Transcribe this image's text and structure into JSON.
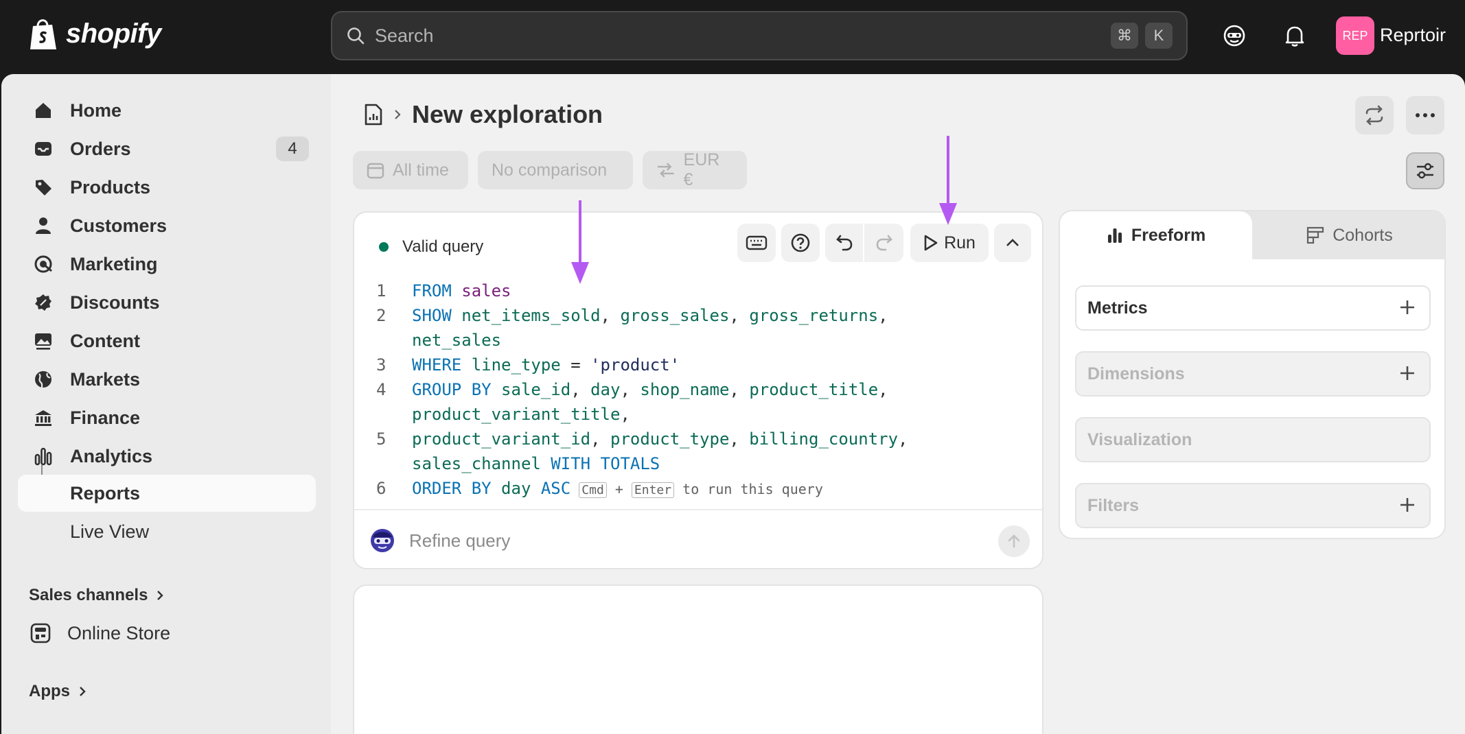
{
  "brand": {
    "name": "shopify"
  },
  "search": {
    "placeholder": "Search",
    "shortcut_keys": [
      "⌘",
      "K"
    ]
  },
  "user": {
    "avatar_text": "REP",
    "store_name": "Reprtoir"
  },
  "sidebar": {
    "items": [
      {
        "label": "Home",
        "icon": "home-icon"
      },
      {
        "label": "Orders",
        "icon": "inbox-icon",
        "badge": "4"
      },
      {
        "label": "Products",
        "icon": "tag-icon"
      },
      {
        "label": "Customers",
        "icon": "person-icon"
      },
      {
        "label": "Marketing",
        "icon": "target-icon"
      },
      {
        "label": "Discounts",
        "icon": "discount-icon"
      },
      {
        "label": "Content",
        "icon": "image-icon"
      },
      {
        "label": "Markets",
        "icon": "globe-icon"
      },
      {
        "label": "Finance",
        "icon": "bank-icon"
      },
      {
        "label": "Analytics",
        "icon": "bar-chart-icon"
      }
    ],
    "sub_items": [
      {
        "label": "Reports",
        "active": true
      },
      {
        "label": "Live View",
        "active": false
      }
    ],
    "sales_channels_title": "Sales channels",
    "online_store_label": "Online Store",
    "apps_title": "Apps"
  },
  "header": {
    "title": "New exploration"
  },
  "filters": {
    "date": "All time",
    "comparison": "No comparison",
    "currency": "EUR €"
  },
  "query": {
    "status": "Valid query",
    "run_label": "Run",
    "refine_placeholder": "Refine query",
    "hint": {
      "prefix": "Cmd",
      "plus": "+",
      "key": "Enter",
      "suffix": "to run this query"
    },
    "lines": [
      {
        "num": "1",
        "tokens": [
          [
            "kw",
            "FROM"
          ],
          [
            "sp",
            " "
          ],
          [
            "tbl",
            "sales"
          ]
        ]
      },
      {
        "num": "2",
        "tokens": [
          [
            "kw",
            "SHOW"
          ],
          [
            "sp",
            " "
          ],
          [
            "fld",
            "net_items_sold"
          ],
          [
            "sp",
            ", "
          ],
          [
            "fld",
            "gross_sales"
          ],
          [
            "sp",
            ", "
          ],
          [
            "fld",
            "gross_returns"
          ],
          [
            "sp",
            ",\n"
          ],
          [
            "fld",
            "net_sales"
          ]
        ]
      },
      {
        "num": "3",
        "tokens": [
          [
            "kw",
            "WHERE"
          ],
          [
            "sp",
            " "
          ],
          [
            "fld",
            "line_type"
          ],
          [
            "sp",
            " = "
          ],
          [
            "str",
            "'product'"
          ]
        ]
      },
      {
        "num": "4",
        "tokens": [
          [
            "kw",
            "GROUP BY"
          ],
          [
            "sp",
            " "
          ],
          [
            "fld",
            "sale_id"
          ],
          [
            "sp",
            ", "
          ],
          [
            "fld",
            "day"
          ],
          [
            "sp",
            ", "
          ],
          [
            "fld",
            "shop_name"
          ],
          [
            "sp",
            ", "
          ],
          [
            "fld",
            "product_title"
          ],
          [
            "sp",
            ",\n"
          ],
          [
            "fld",
            "product_variant_title"
          ],
          [
            "sp",
            ","
          ]
        ]
      },
      {
        "num": "5",
        "tokens": [
          [
            "fld",
            "product_variant_id"
          ],
          [
            "sp",
            ", "
          ],
          [
            "fld",
            "product_type"
          ],
          [
            "sp",
            ", "
          ],
          [
            "fld",
            "billing_country"
          ],
          [
            "sp",
            ",\n"
          ],
          [
            "fld",
            "sales_channel"
          ],
          [
            "sp",
            " "
          ],
          [
            "kw",
            "WITH TOTALS"
          ]
        ]
      },
      {
        "num": "6",
        "tokens": [
          [
            "kw",
            "ORDER BY"
          ],
          [
            "sp",
            " "
          ],
          [
            "fld",
            "day"
          ],
          [
            "sp",
            " "
          ],
          [
            "kw",
            "ASC"
          ]
        ]
      }
    ]
  },
  "panel": {
    "tabs": [
      {
        "label": "Freeform"
      },
      {
        "label": "Cohorts"
      }
    ],
    "rows": [
      {
        "label": "Metrics"
      },
      {
        "label": "Dimensions"
      },
      {
        "label": "Visualization"
      },
      {
        "label": "Filters"
      }
    ]
  },
  "colors": {
    "accent_arrow": "#b45af2",
    "avatar_bg": "#ff5fa2",
    "status_ok": "#007a5a"
  }
}
